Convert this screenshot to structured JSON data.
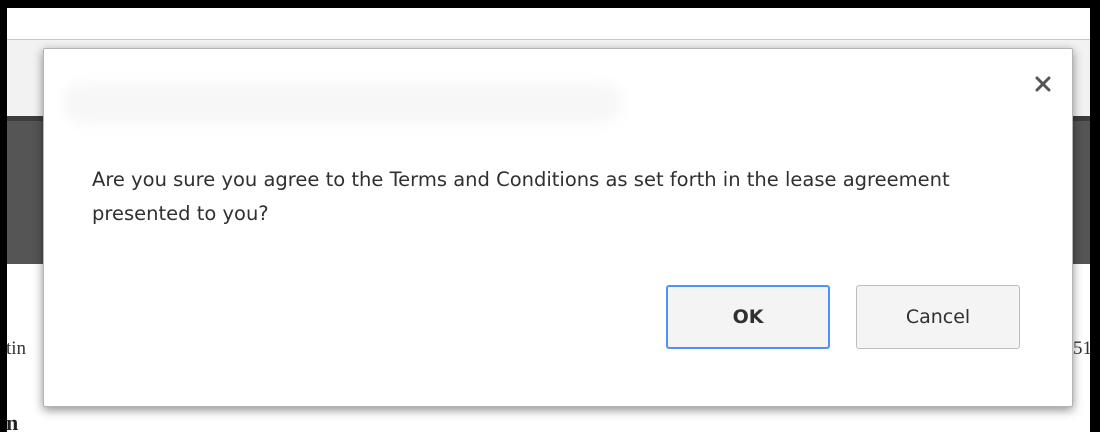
{
  "dialog": {
    "message": "Are you sure you agree to the Terms and Conditions as set forth in the lease agreement presented to you?",
    "ok_label": "OK",
    "cancel_label": "Cancel",
    "close_icon": "close-icon"
  },
  "background": {
    "left_text": "tin",
    "right_text": "51",
    "bottom_text": "n"
  },
  "colors": {
    "focus_border": "#4d90fe",
    "header_gray": "#555555",
    "page_light": "#f2f2f2"
  }
}
